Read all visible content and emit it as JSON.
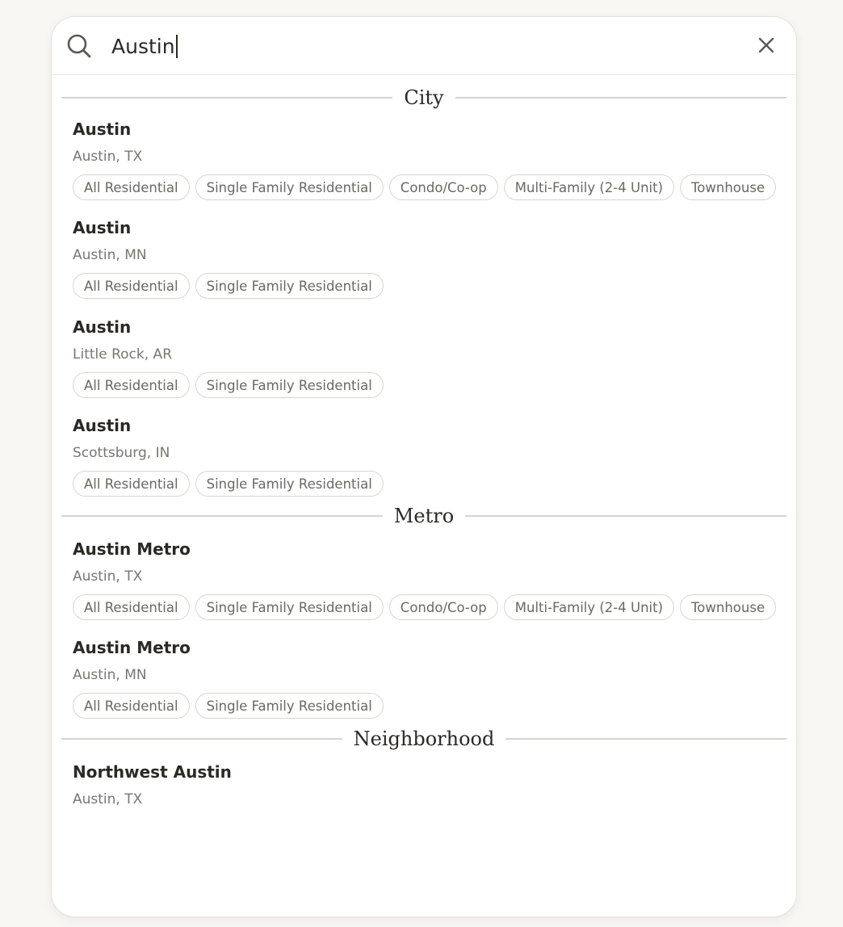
{
  "search": {
    "value": "Austin"
  },
  "sections": [
    {
      "title": "City",
      "items": [
        {
          "name": "Austin",
          "location": "Austin, TX",
          "chips": [
            "All Residential",
            "Single Family Residential",
            "Condo/Co-op",
            "Multi-Family (2-4 Unit)",
            "Townhouse"
          ]
        },
        {
          "name": "Austin",
          "location": "Austin, MN",
          "chips": [
            "All Residential",
            "Single Family Residential"
          ]
        },
        {
          "name": "Austin",
          "location": "Little Rock, AR",
          "chips": [
            "All Residential",
            "Single Family Residential"
          ]
        },
        {
          "name": "Austin",
          "location": "Scottsburg, IN",
          "chips": [
            "All Residential",
            "Single Family Residential"
          ]
        }
      ]
    },
    {
      "title": "Metro",
      "items": [
        {
          "name": "Austin Metro",
          "location": "Austin, TX",
          "chips": [
            "All Residential",
            "Single Family Residential",
            "Condo/Co-op",
            "Multi-Family (2-4 Unit)",
            "Townhouse"
          ]
        },
        {
          "name": "Austin Metro",
          "location": "Austin, MN",
          "chips": [
            "All Residential",
            "Single Family Residential"
          ]
        }
      ]
    },
    {
      "title": "Neighborhood",
      "items": [
        {
          "name": "Northwest Austin",
          "location": "Austin, TX",
          "chips": []
        }
      ]
    }
  ],
  "icons": {
    "search": "search-icon",
    "clear": "close-icon"
  },
  "colors": {
    "background": "#f8f7f4",
    "text": "#2b2924",
    "muted": "#7a766e",
    "chip_border": "#d9d6d0",
    "divider": "#d7d4ce"
  }
}
